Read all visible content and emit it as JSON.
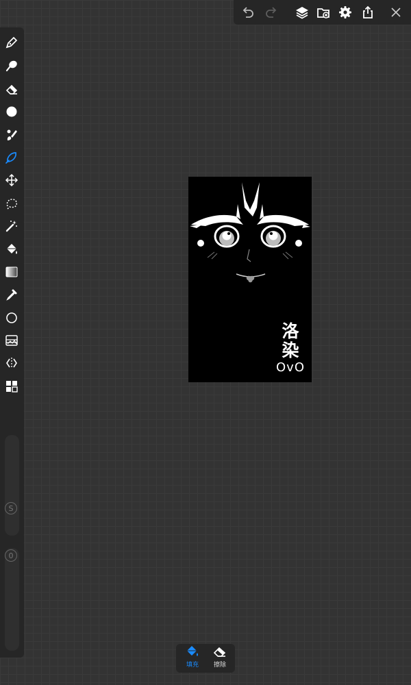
{
  "colors": {
    "accent": "#1a8cff",
    "toolbar_bg": "#262626",
    "canvas_bg": "#333333",
    "icon": "#ffffff",
    "icon_disabled": "#6a6a6a"
  },
  "topbar": {
    "icons": [
      "undo-icon",
      "redo-icon",
      "layers-icon",
      "import-icon",
      "settings-icon",
      "share-icon",
      "close-icon"
    ],
    "redo_enabled": false
  },
  "toolbar": {
    "active_tool": "lasso-fill-tool",
    "tools": [
      "pen-tool",
      "smudge-tool",
      "eraser-tool",
      "color-tool",
      "brush-tool",
      "lasso-fill-tool",
      "transform-tool",
      "selection-tool",
      "magic-wand-tool",
      "fill-tool",
      "gradient-tool",
      "eyedropper-tool",
      "shape-tool",
      "adjust-tool",
      "symmetry-tool",
      "more-tool"
    ],
    "size_label": "S",
    "opacity_label": "0"
  },
  "artwork": {
    "signature_line1": "洛",
    "signature_line2": "染",
    "signature_line3": "OvO"
  },
  "bottombar": {
    "fill_label": "填充",
    "erase_label": "擦除"
  }
}
